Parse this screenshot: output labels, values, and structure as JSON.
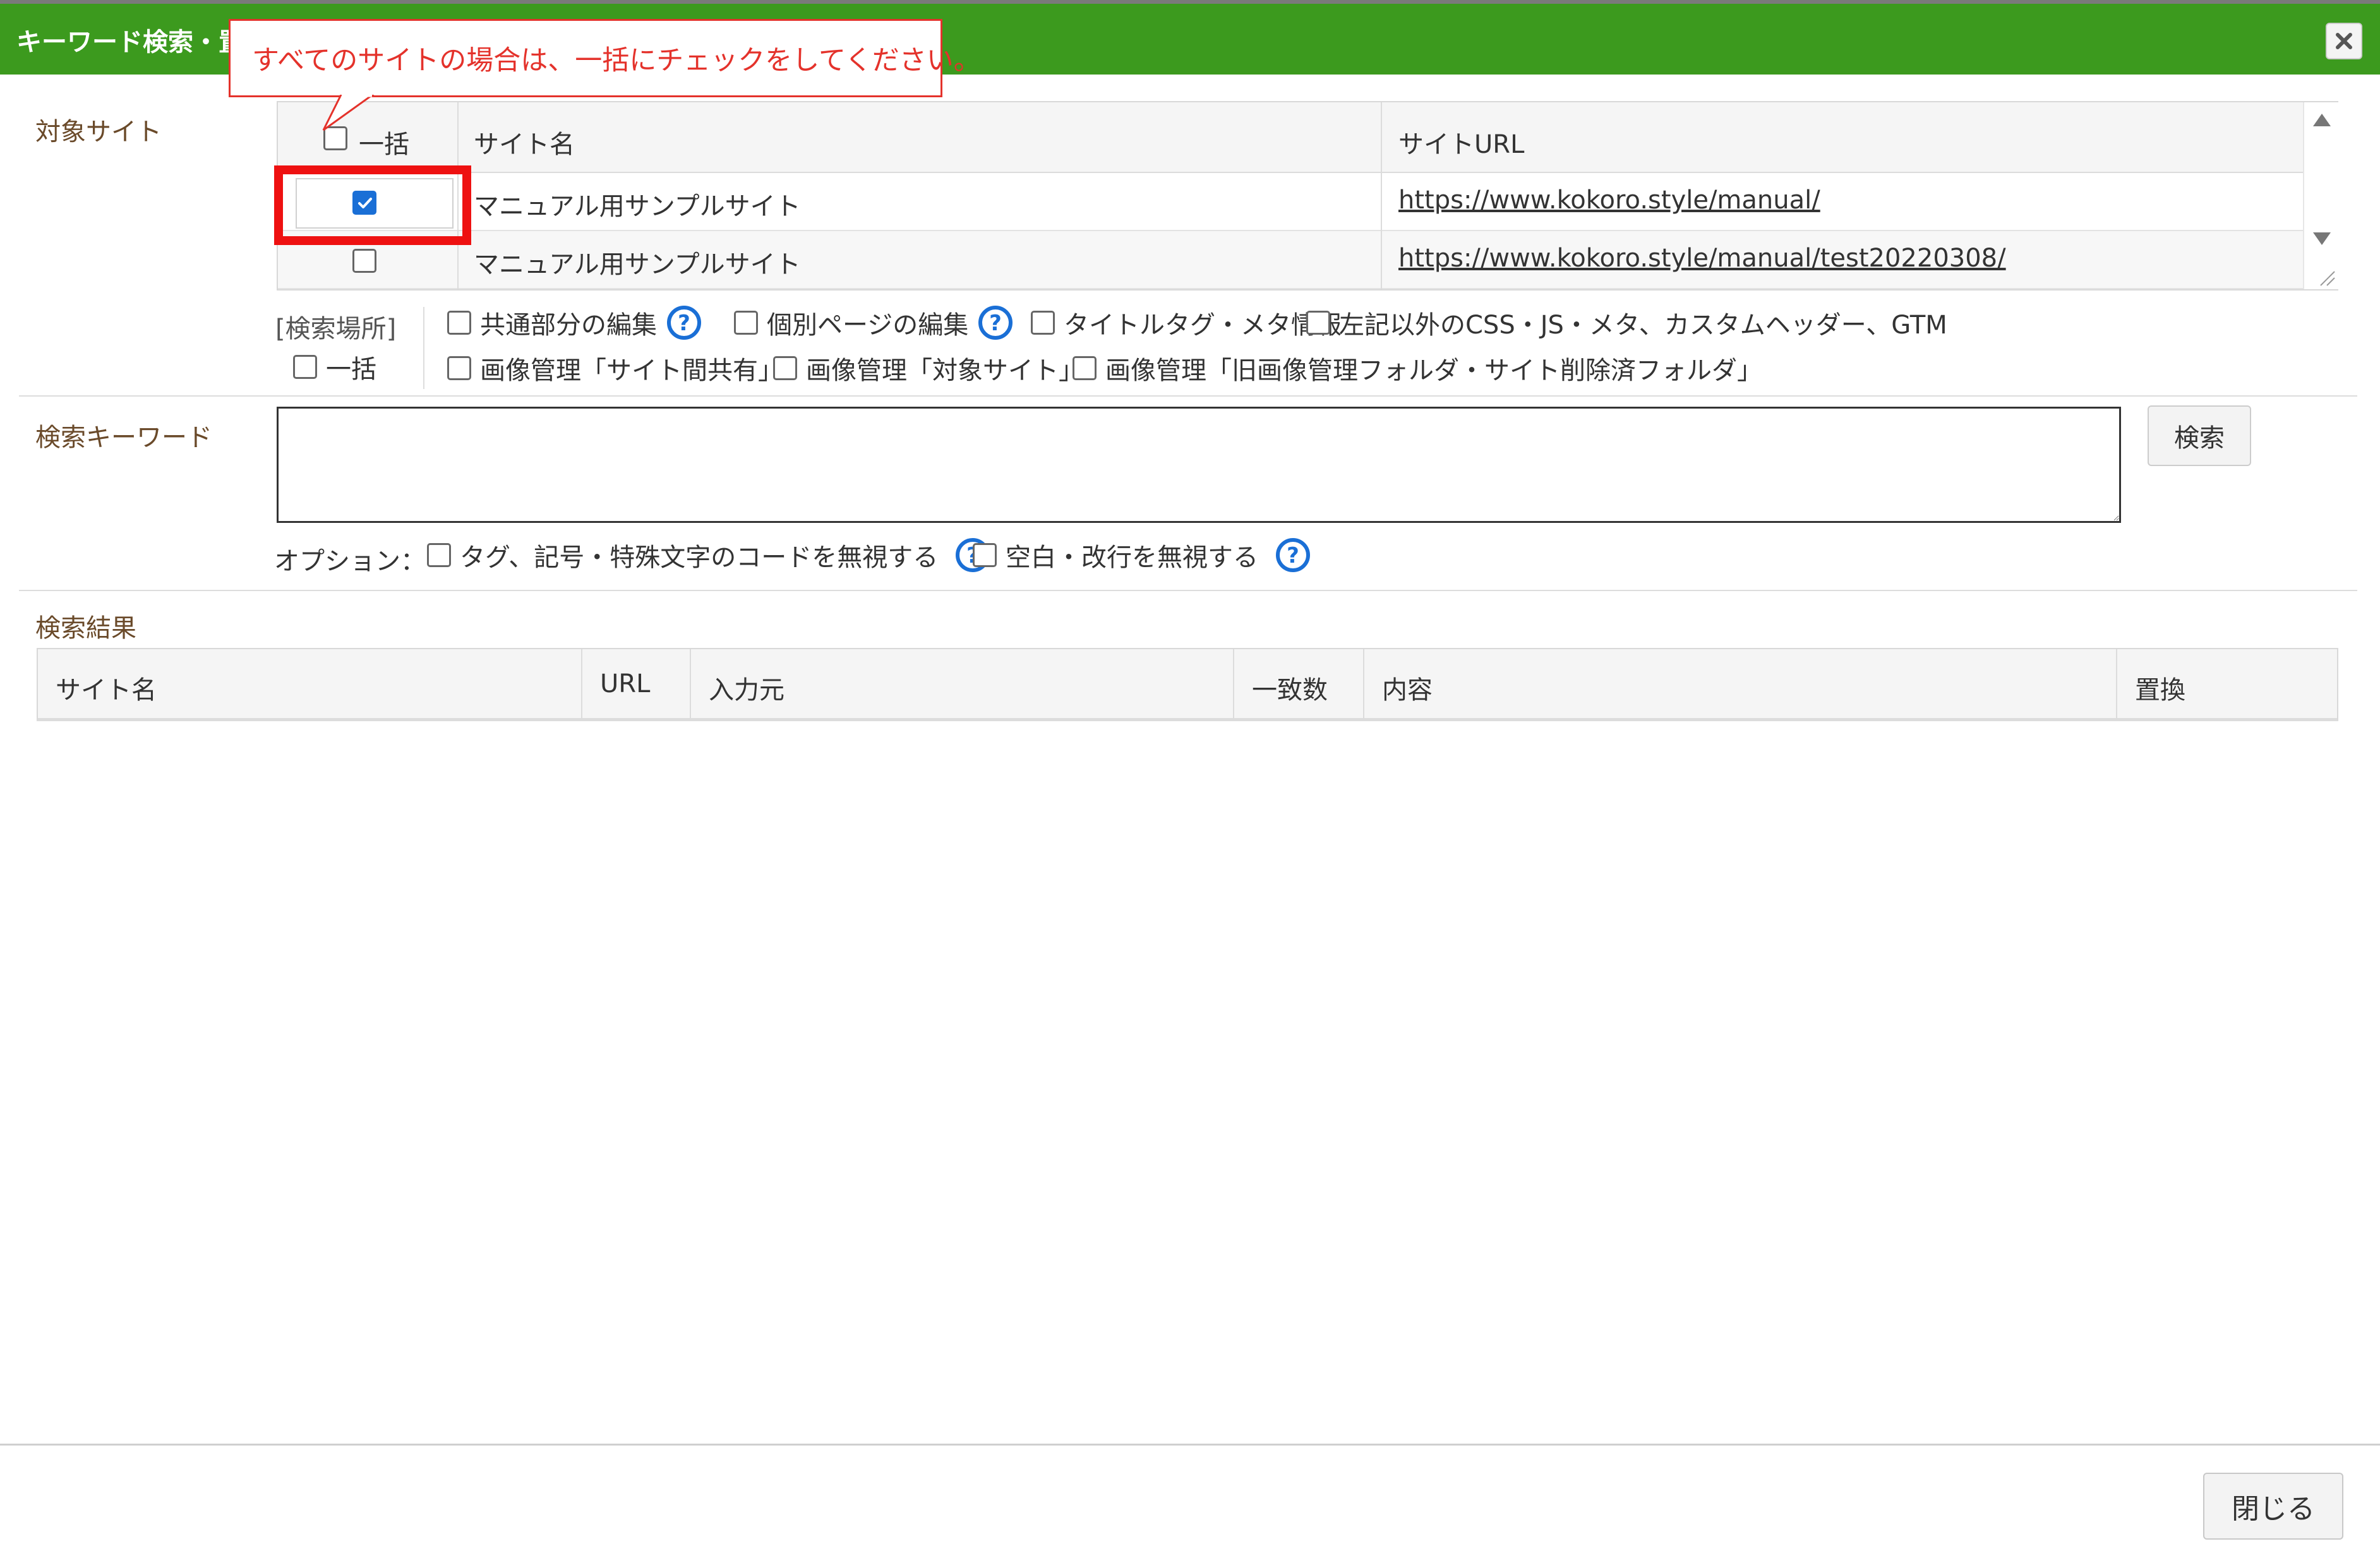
{
  "dialog": {
    "title": "キーワード検索・置換",
    "close_glyph": "✖"
  },
  "callout": {
    "text": "すべてのサイトの場合は、一括にチェックをしてください。",
    "color": "#e4322b"
  },
  "target_sites": {
    "label": "対象サイト",
    "headers": {
      "all": "一括",
      "site_name": "サイト名",
      "site_url": "サイトURL"
    },
    "rows": [
      {
        "checked": true,
        "name": "マニュアル用サンプルサイト",
        "url": "https://www.kokoro.style/manual/"
      },
      {
        "checked": false,
        "name": "マニュアル用サンプルサイト",
        "url": "https://www.kokoro.style/manual/test20220308/"
      }
    ]
  },
  "search_location": {
    "label": "[検索場所]",
    "all_label": "一括",
    "options": [
      {
        "label": "共通部分の編集",
        "help": true
      },
      {
        "label": "個別ページの編集",
        "help": true
      },
      {
        "label": "タイトルタグ・メタ情報",
        "help": false
      },
      {
        "label": "左記以外のCSS・JS・メタ、カスタムヘッダー、GTM",
        "help": false
      },
      {
        "label": "画像管理「サイト間共有」",
        "help": false
      },
      {
        "label": "画像管理「対象サイト」",
        "help": false
      },
      {
        "label": "画像管理「旧画像管理フォルダ・サイト削除済フォルダ」",
        "help": false
      }
    ]
  },
  "keyword": {
    "label": "検索キーワード",
    "value": "",
    "search_button": "検索",
    "options_label": "オプション：",
    "options": [
      {
        "label": "タグ、記号・特殊文字のコードを無視する",
        "help": true
      },
      {
        "label": "空白・改行を無視する",
        "help": true
      }
    ]
  },
  "results": {
    "label": "検索結果",
    "columns": [
      "サイト名",
      "URL",
      "入力元",
      "一致数",
      "内容",
      "置換"
    ]
  },
  "footer": {
    "close_button": "閉じる"
  },
  "colors": {
    "titlebar": "#3c9a1e",
    "highlight": "#ee1111",
    "checkbox_checked": "#1a6fd6",
    "help_icon": "#1a6fd6"
  }
}
